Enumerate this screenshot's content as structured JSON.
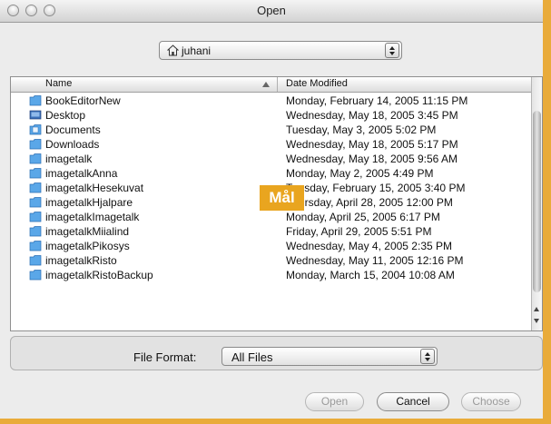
{
  "window": {
    "title": "Open"
  },
  "path_popup": {
    "current": "juhani"
  },
  "columns": {
    "name": "Name",
    "date": "Date Modified"
  },
  "files": [
    {
      "name": "BookEditorNew",
      "date": "Monday, February 14, 2005 11:15 PM",
      "icon": "folder-icon"
    },
    {
      "name": "Desktop",
      "date": "Wednesday, May 18, 2005 3:45 PM",
      "icon": "desktop-folder-icon"
    },
    {
      "name": "Documents",
      "date": "Tuesday, May 3, 2005 5:02 PM",
      "icon": "documents-folder-icon"
    },
    {
      "name": "Downloads",
      "date": "Wednesday, May 18, 2005 5:17 PM",
      "icon": "folder-icon"
    },
    {
      "name": "imagetalk",
      "date": "Wednesday, May 18, 2005 9:56 AM",
      "icon": "folder-icon"
    },
    {
      "name": "imagetalkAnna",
      "date": "Monday, May 2, 2005 4:49 PM",
      "icon": "folder-icon"
    },
    {
      "name": "imagetalkHesekuvat",
      "date": "Tuesday, February 15, 2005 3:40 PM",
      "icon": "folder-icon"
    },
    {
      "name": "imagetalkHjalpare",
      "date": "Thursday, April 28, 2005 12:00 PM",
      "icon": "folder-icon"
    },
    {
      "name": "imagetalkImagetalk",
      "date": "Monday, April 25, 2005 6:17 PM",
      "icon": "folder-icon"
    },
    {
      "name": "imagetalkMiialind",
      "date": "Friday, April 29, 2005 5:51 PM",
      "icon": "folder-icon"
    },
    {
      "name": "imagetalkPikosys",
      "date": "Wednesday, May 4, 2005 2:35 PM",
      "icon": "folder-icon"
    },
    {
      "name": "imagetalkRisto",
      "date": "Wednesday, May 11, 2005 12:16 PM",
      "icon": "folder-icon"
    },
    {
      "name": "imagetalkRistoBackup",
      "date": "Monday, March 15, 2004 10:08 AM",
      "icon": "folder-icon"
    }
  ],
  "file_format": {
    "label": "File Format:",
    "selected": "All Files"
  },
  "buttons": {
    "open": "Open",
    "cancel": "Cancel",
    "choose": "Choose"
  },
  "overlay": {
    "text": "Mål"
  },
  "colors": {
    "accent": "#e9ab3a",
    "folder": "#5aa7e8"
  }
}
